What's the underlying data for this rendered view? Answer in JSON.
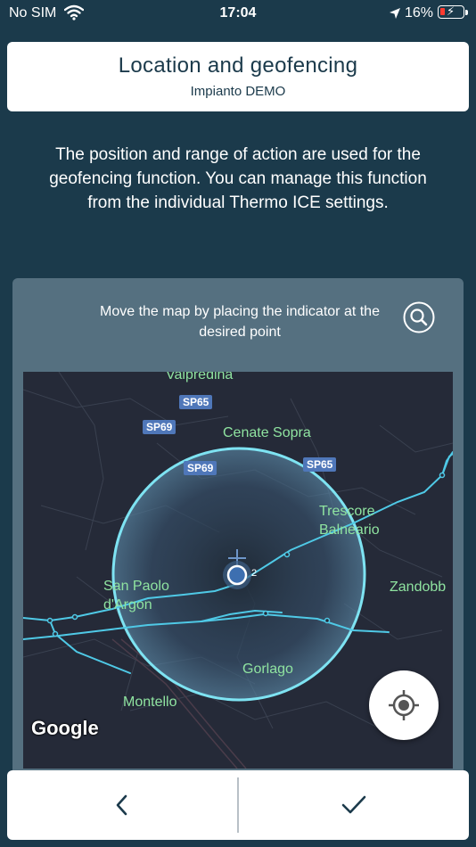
{
  "status_bar": {
    "carrier": "No SIM",
    "time": "17:04",
    "battery": "16%",
    "battery_level": 0.16
  },
  "header": {
    "title": "Location and geofencing",
    "subtitle": "Impianto DEMO"
  },
  "description": "The position and range of action are used for the geofencing function. You can manage this function from the individual Thermo ICE settings.",
  "map_panel": {
    "hint": "Move the map by placing the indicator at the desired point",
    "search_icon": "search-icon",
    "locate_icon": "crosshair-icon",
    "attribution": "Google",
    "marker_label": "2",
    "road_labels": [
      "SP65",
      "SP69",
      "SP69",
      "SP65"
    ],
    "places": [
      "Valpredina",
      "Cenate Sopra",
      "Trescore Balneario",
      "San Paolo d'Argon",
      "Zandobb",
      "Gorlago",
      "Montello"
    ],
    "colors": {
      "geofence_stroke": "#7ee3f2",
      "road": "#4fc9e6",
      "place_label": "#8fe3a0"
    }
  },
  "bottom_bar": {
    "back_icon": "chevron-left-icon",
    "confirm_icon": "checkmark-icon"
  }
}
